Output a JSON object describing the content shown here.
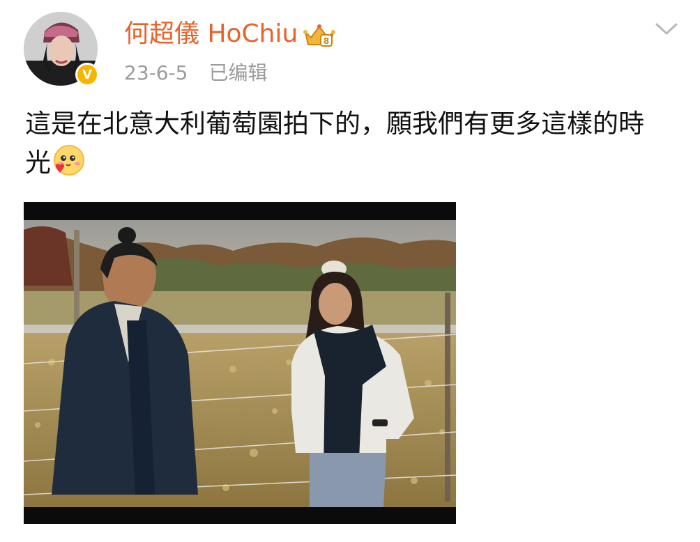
{
  "post": {
    "author": {
      "name": "何超儀 HoChiu",
      "verified_badge": "V"
    },
    "date": "23-6-5",
    "edited_label": "已编辑",
    "text": "這是在北意大利葡萄園拍下的，願我們有更多這樣的時光",
    "icons": {
      "more": "chevron-down-icon",
      "vip": "crown-badge-icon",
      "emoji": "cute-love-emoji-icon"
    },
    "photo": {
      "description_icon": "vineyard-photo"
    }
  }
}
